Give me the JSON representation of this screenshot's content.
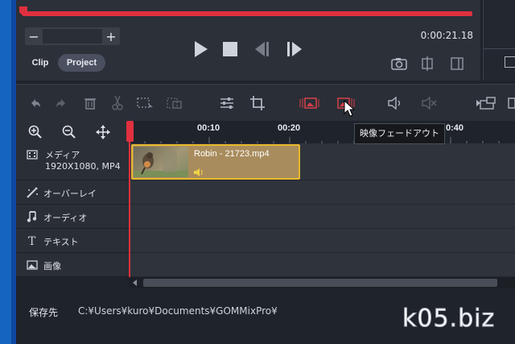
{
  "colors": {
    "accent_red": "#e0303f",
    "clip_border": "#e8b82e",
    "panel_bg": "#2a2e36",
    "window_blue": "#1565c0"
  },
  "preview": {
    "timecode": "0:00:21.18",
    "stepper_minus": "−",
    "stepper_plus": "+",
    "tabs": [
      {
        "label": "Clip",
        "active": false
      },
      {
        "label": "Project",
        "active": true
      }
    ],
    "playback_icons": [
      "play-icon",
      "stop-icon",
      "prev-frame-icon",
      "next-frame-icon"
    ],
    "side_icons": [
      "snapshot-icon",
      "split-view-icon",
      "fit-view-icon"
    ]
  },
  "toolbar": {
    "icons": [
      "undo-icon",
      "redo-icon",
      "delete-icon",
      "cut-icon",
      "select-range-icon",
      "crop-range-icon",
      "adjust-icon",
      "crop-icon",
      "video-fade-in-icon",
      "video-fade-out-icon",
      "audio-fade-icon",
      "mute-icon",
      "pip-icon"
    ],
    "tooltip": "映像フェードアウト"
  },
  "ruler": {
    "icons": [
      "zoom-in-icon",
      "zoom-out-icon",
      "fit-icon"
    ],
    "ticks": [
      "00:10",
      "00:20",
      "0:40"
    ]
  },
  "tracks": [
    {
      "icon": "film-icon",
      "label": "メディア",
      "sub": "1920X1080, MP4"
    },
    {
      "icon": "overlay-icon",
      "label": "オーバーレイ"
    },
    {
      "icon": "music-icon",
      "label": "オーディオ"
    },
    {
      "icon": "text-icon",
      "label": "テキスト"
    },
    {
      "icon": "image-icon",
      "label": "画像"
    }
  ],
  "clip": {
    "title": "Robin - 21723.mp4"
  },
  "footer": {
    "save_label": "保存先",
    "save_path": "C:¥Users¥kuro¥Documents¥GOMMixPro¥"
  },
  "watermark": "k05.biz"
}
